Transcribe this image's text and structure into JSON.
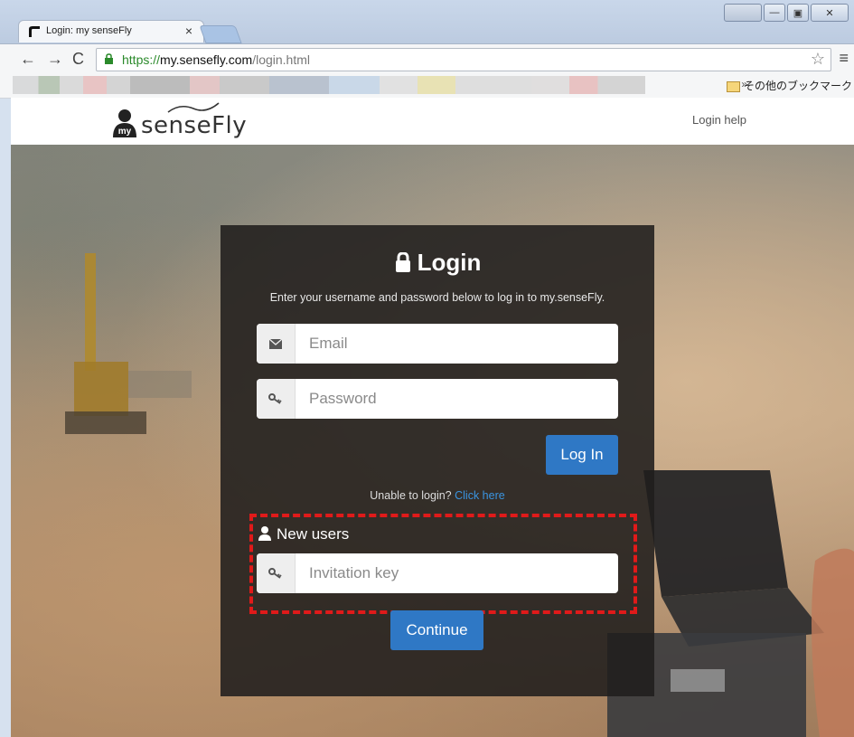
{
  "browser": {
    "tab_title": "Login: my senseFly",
    "tab_close": "×",
    "url_scheme": "https://",
    "url_host": "my.sensefly.com",
    "url_path": "/login.html",
    "bookmarks_more": "»",
    "other_bookmarks": "その他のブックマーク",
    "window_min": "—",
    "window_max": "▣",
    "window_close": "✕"
  },
  "header": {
    "brand_text": "senseFly",
    "brand_badge": "my",
    "login_help": "Login help"
  },
  "login": {
    "title": "Login",
    "subtitle": "Enter your username and password below to log in to my.senseFly.",
    "email_placeholder": "Email",
    "password_placeholder": "Password",
    "login_button": "Log In",
    "unable_text": "Unable to login?",
    "click_here": "Click here",
    "new_users_label": "New users",
    "invitation_placeholder": "Invitation key",
    "continue_button": "Continue"
  },
  "colors": {
    "accent_blue": "#2f78c5",
    "highlight_red": "#e01a1a",
    "link_blue": "#3a94e0"
  }
}
